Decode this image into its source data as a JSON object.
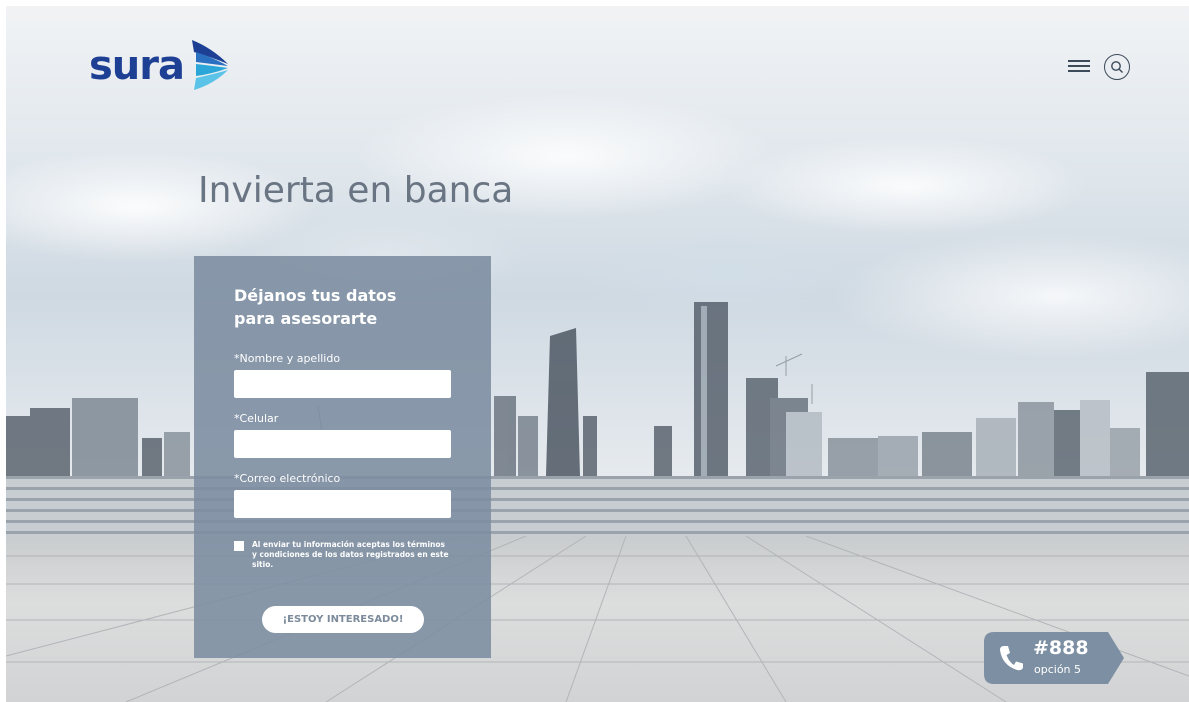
{
  "brand": {
    "name": "sura",
    "color": "#1d3f94",
    "accent": "#2aa6d8"
  },
  "header": {
    "menu_icon": "hamburger-menu-icon",
    "search_icon": "search-icon"
  },
  "hero": {
    "title": "Invierta en banca"
  },
  "form": {
    "title_line1": "Déjanos tus datos",
    "title_line2": "para asesorarte",
    "fields": [
      {
        "label": "*Nombre y apellido",
        "value": ""
      },
      {
        "label": "*Celular",
        "value": ""
      },
      {
        "label": "*Correo electrónico",
        "value": ""
      }
    ],
    "terms_line1": "Al enviar tu información aceptas los términos",
    "terms_line2": "y condiciones de los datos registrados en este sitio.",
    "terms_checked": false,
    "submit_label": "¡ESTOY INTERESADO!"
  },
  "contact": {
    "number": "#888",
    "option": "opción 5",
    "icon": "phone-icon"
  }
}
